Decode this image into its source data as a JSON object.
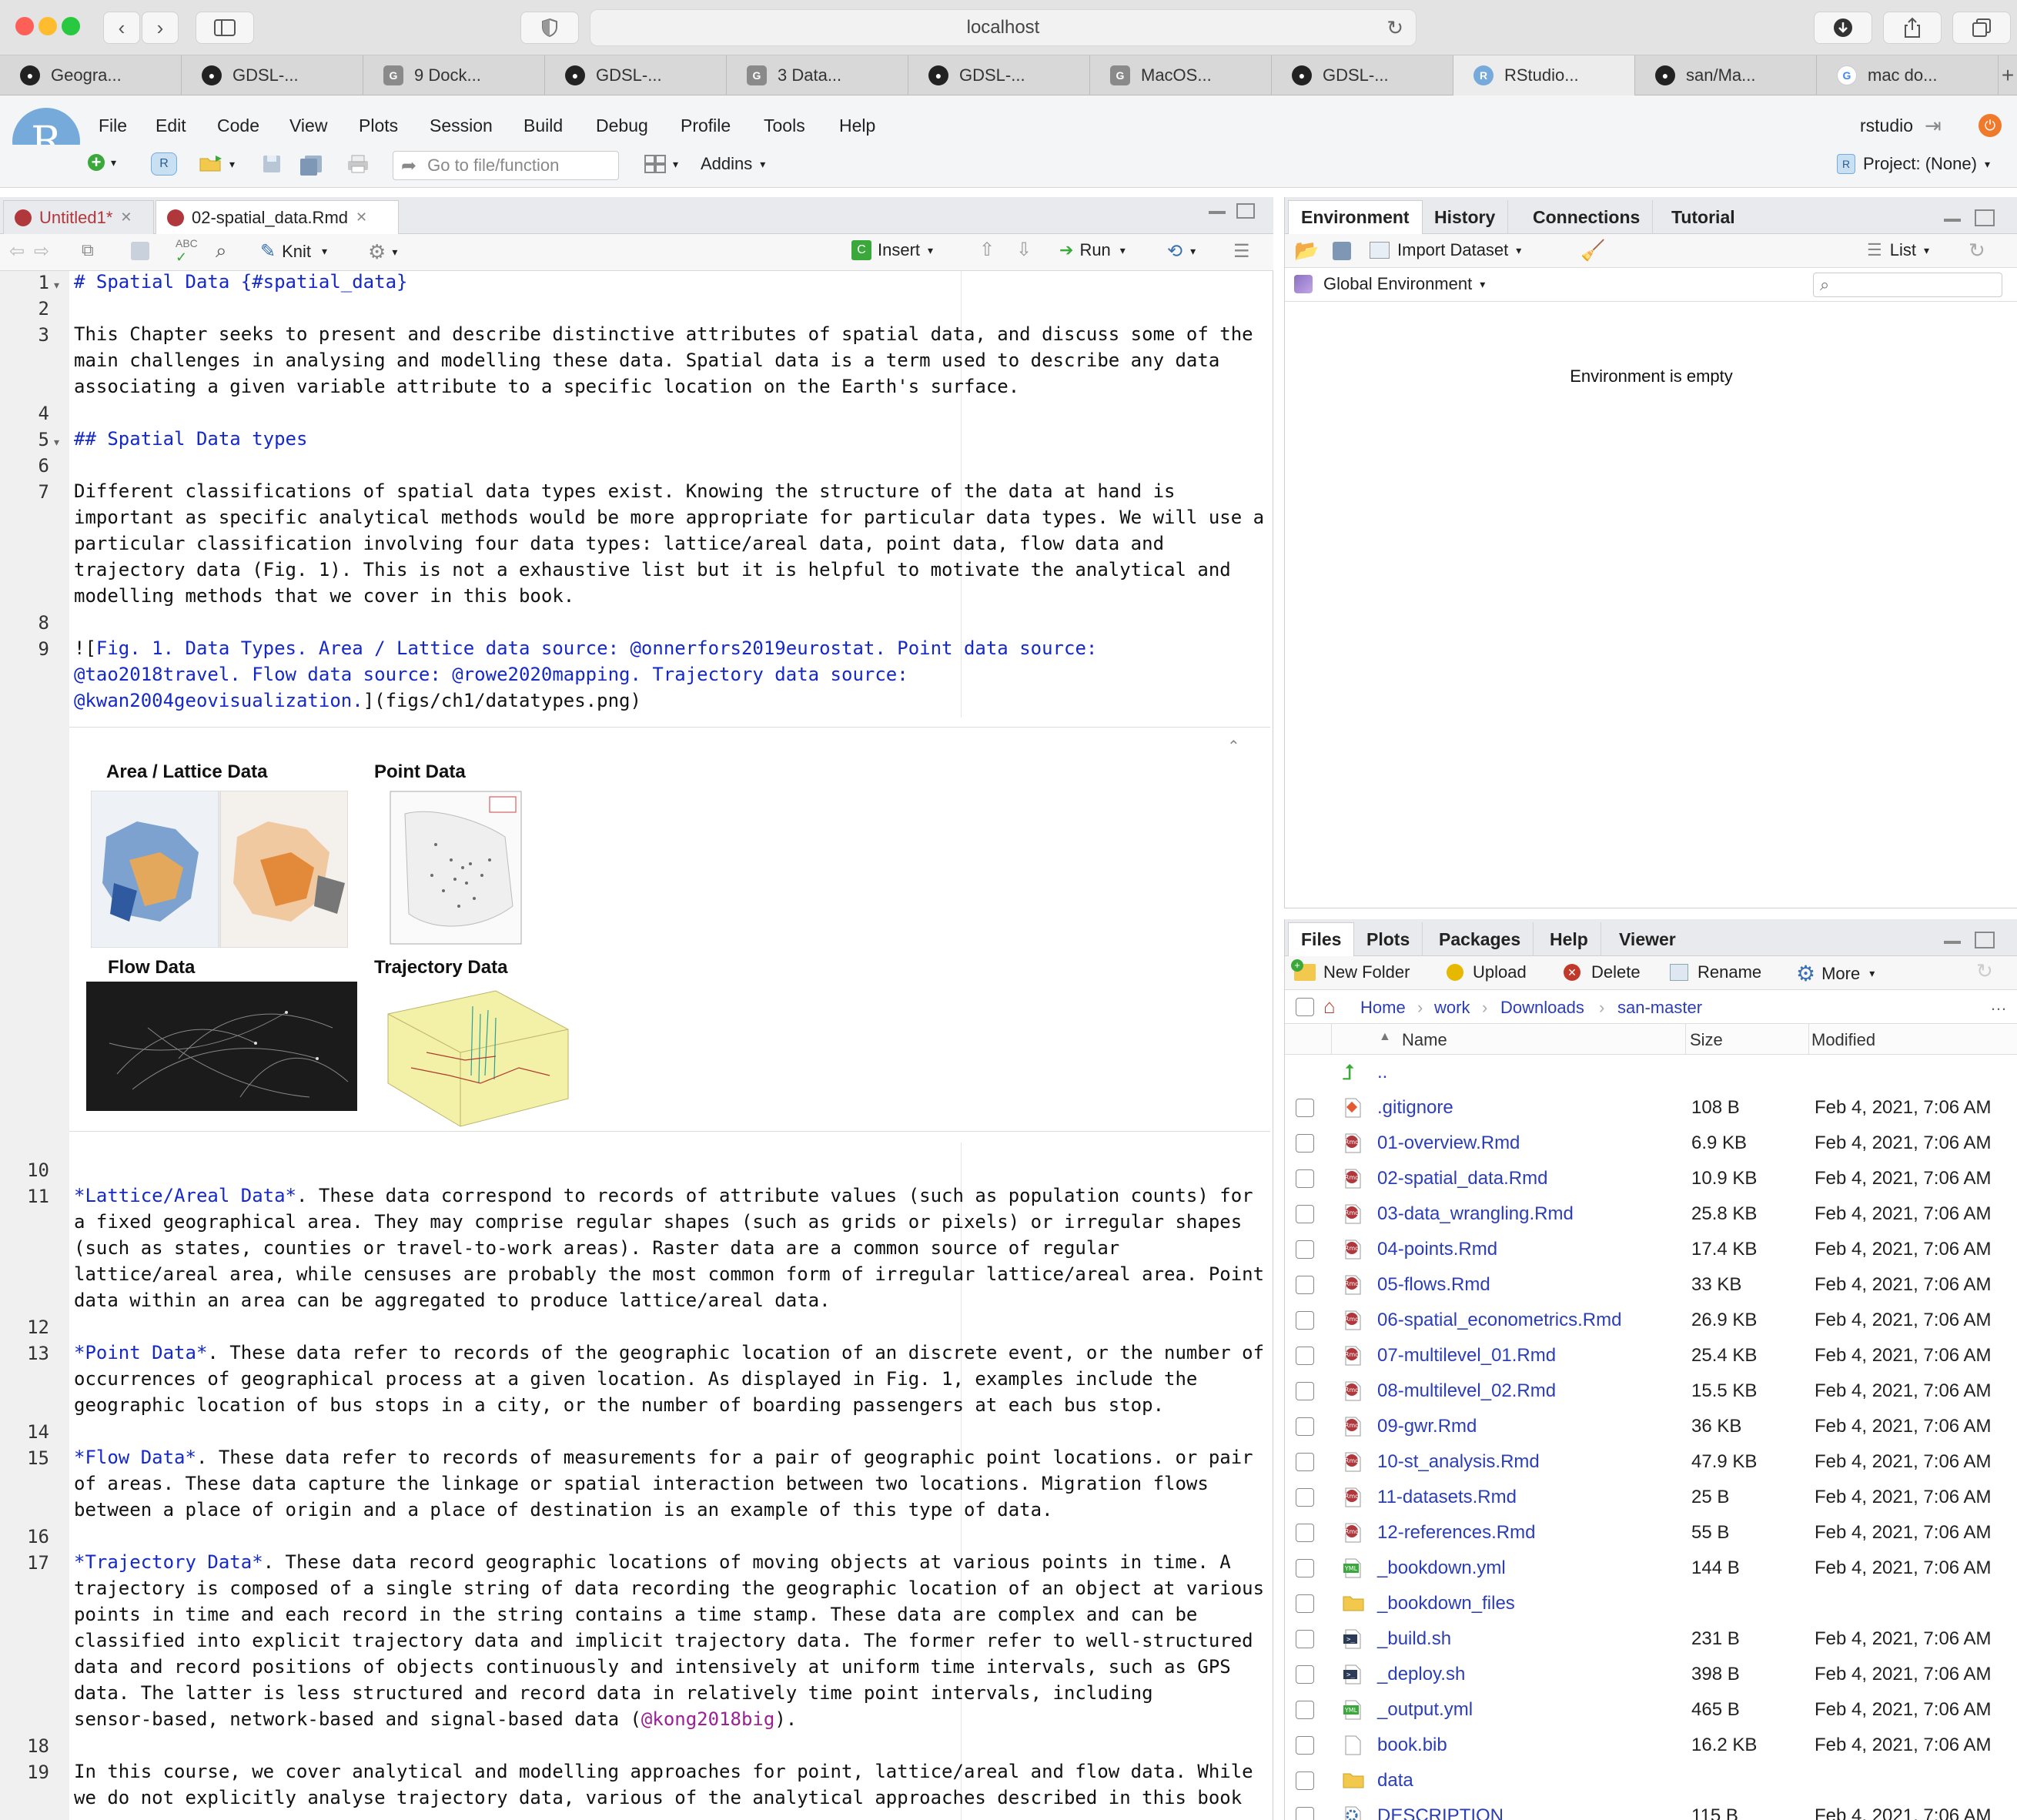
{
  "browser": {
    "url": "localhost",
    "tabs": [
      {
        "label": "Geogra...",
        "icon": "github-icon"
      },
      {
        "label": "GDSL-...",
        "icon": "github-icon"
      },
      {
        "label": "9 Dock...",
        "icon": "g-icon"
      },
      {
        "label": "GDSL-...",
        "icon": "github-icon"
      },
      {
        "label": "3 Data...",
        "icon": "g-icon"
      },
      {
        "label": "GDSL-...",
        "icon": "github-icon"
      },
      {
        "label": "MacOS...",
        "icon": "g-icon"
      },
      {
        "label": "GDSL-...",
        "icon": "github-icon"
      },
      {
        "label": "RStudio...",
        "icon": "rstudio-icon"
      },
      {
        "label": "san/Ma...",
        "icon": "github-icon"
      },
      {
        "label": "mac do...",
        "icon": "google-icon"
      }
    ]
  },
  "rstudio": {
    "logo": "R",
    "menu": [
      "File",
      "Edit",
      "Code",
      "View",
      "Plots",
      "Session",
      "Build",
      "Debug",
      "Profile",
      "Tools",
      "Help"
    ],
    "user": "rstudio",
    "goto_placeholder": "Go to file/function",
    "addins": "Addins",
    "project": "Project: (None)"
  },
  "editor": {
    "tabs": [
      {
        "label": "Untitled1*",
        "modified": true
      },
      {
        "label": "02-spatial_data.Rmd",
        "modified": false
      }
    ],
    "toolbar": {
      "knit": "Knit",
      "insert": "Insert",
      "run": "Run"
    },
    "lines": [
      {
        "n": "1",
        "parts": [
          {
            "t": "# Spatial Data {#spatial_data}",
            "c": "hd"
          }
        ]
      },
      {
        "n": "2",
        "parts": []
      },
      {
        "n": "3",
        "parts": [
          {
            "t": "This Chapter seeks to present and describe distinctive attributes of spatial data, and discuss some of the\nmain challenges in analysing and modelling these data. Spatial data is a term used to describe any data\nassociating a given variable attribute to a specific location on the Earth's surface.",
            "c": ""
          }
        ]
      },
      {
        "n": "4",
        "parts": []
      },
      {
        "n": "5",
        "parts": [
          {
            "t": "## Spatial Data types",
            "c": "hd"
          }
        ]
      },
      {
        "n": "6",
        "parts": []
      },
      {
        "n": "7",
        "parts": [
          {
            "t": "Different classifications of spatial data types exist. Knowing the structure of the data at hand is\nimportant as specific analytical methods would be more appropriate for particular data types. We will use a\nparticular classification involving four data types: lattice/areal data, point data, flow data and\ntrajectory data (Fig. 1). This is not a exhaustive list but it is helpful to motivate the analytical and\nmodelling methods that we cover in this book.",
            "c": ""
          }
        ]
      },
      {
        "n": "8",
        "parts": []
      },
      {
        "n": "9",
        "parts": [
          {
            "t": "![",
            "c": ""
          },
          {
            "t": "Fig. 1. Data Types. Area / Lattice data source: @onnerfors2019eurostat. Point data source:\n@tao2018travel. Flow data source: @rowe2020mapping. Trajectory data source:\n@kwan2004geovisualization.",
            "c": "lk"
          },
          {
            "t": "](figs/ch1/datatypes.png)",
            "c": ""
          }
        ]
      }
    ],
    "figure_labels": {
      "area": "Area / Lattice Data",
      "point": "Point Data",
      "flow": "Flow Data",
      "trajectory": "Trajectory Data"
    },
    "lines2": [
      {
        "n": "10",
        "parts": []
      },
      {
        "n": "11",
        "parts": [
          {
            "t": "*Lattice/Areal Data*",
            "c": "lk"
          },
          {
            "t": ". These data correspond to records of attribute values (such as population counts) for\na fixed geographical area. They may comprise regular shapes (such as grids or pixels) or irregular shapes\n(such as states, counties or travel-to-work areas). Raster data are a common source of regular\nlattice/areal area, while censuses are probably the most common form of irregular lattice/areal area. Point\ndata within an area can be aggregated to produce lattice/areal data.",
            "c": ""
          }
        ]
      },
      {
        "n": "12",
        "parts": []
      },
      {
        "n": "13",
        "parts": [
          {
            "t": "*Point Data*",
            "c": "lk"
          },
          {
            "t": ". These data refer to records of the geographic location of an discrete event, or the number of\noccurrences of geographical process at a given location. As displayed in Fig. 1, examples include the\ngeographic location of bus stops in a city, or the number of boarding passengers at each bus stop.",
            "c": ""
          }
        ]
      },
      {
        "n": "14",
        "parts": []
      },
      {
        "n": "15",
        "parts": [
          {
            "t": "*Flow Data*",
            "c": "lk"
          },
          {
            "t": ". These data refer to records of measurements for a pair of geographic point locations. or pair\nof areas. These data capture the linkage or spatial interaction between two locations. Migration flows\nbetween a place of origin and a place of destination is an example of this type of data.",
            "c": ""
          }
        ]
      },
      {
        "n": "16",
        "parts": []
      },
      {
        "n": "17",
        "parts": [
          {
            "t": "*Trajectory Data*",
            "c": "lk"
          },
          {
            "t": ". These data record geographic locations of moving objects at various points in time. A\ntrajectory is composed of a single string of data recording the geographic location of an object at various\npoints in time and each record in the string contains a time stamp. These data are complex and can be\nclassified into explicit trajectory data and implicit trajectory data. The former refer to well-structured\ndata and record positions of objects continuously and intensively at uniform time intervals, such as GPS\ndata. The latter is less structured and record data in relatively time point intervals, including\nsensor-based, network-based and signal-based data (",
            "c": ""
          },
          {
            "t": "@kong2018big",
            "c": "cite"
          },
          {
            "t": ").",
            "c": ""
          }
        ]
      },
      {
        "n": "18",
        "parts": []
      },
      {
        "n": "19",
        "parts": [
          {
            "t": "In this course, we cover analytical and modelling approaches for point, lattice/areal and flow data. While\nwe do not explicitly analyse trajectory data, various of the analytical approaches described in this book",
            "c": ""
          }
        ]
      }
    ]
  },
  "environment": {
    "tabs": [
      "Environment",
      "History",
      "Connections",
      "Tutorial"
    ],
    "import_dataset": "Import Dataset",
    "list_view": "List",
    "scope": "Global Environment",
    "empty_message": "Environment is empty"
  },
  "files": {
    "tabs": [
      "Files",
      "Plots",
      "Packages",
      "Help",
      "Viewer"
    ],
    "actions": {
      "new_folder": "New Folder",
      "upload": "Upload",
      "delete": "Delete",
      "rename": "Rename",
      "more": "More"
    },
    "breadcrumb": [
      "Home",
      "work",
      "Downloads",
      "san-master"
    ],
    "columns": {
      "name": "Name",
      "size": "Size",
      "modified": "Modified"
    },
    "parent": "..",
    "rows": [
      {
        "name": ".gitignore",
        "size": "108 B",
        "modified": "Feb 4, 2021, 7:06 AM",
        "icon": "git-file-icon"
      },
      {
        "name": "01-overview.Rmd",
        "size": "6.9 KB",
        "modified": "Feb 4, 2021, 7:06 AM",
        "icon": "rmd-file-icon"
      },
      {
        "name": "02-spatial_data.Rmd",
        "size": "10.9 KB",
        "modified": "Feb 4, 2021, 7:06 AM",
        "icon": "rmd-file-icon"
      },
      {
        "name": "03-data_wrangling.Rmd",
        "size": "25.8 KB",
        "modified": "Feb 4, 2021, 7:06 AM",
        "icon": "rmd-file-icon"
      },
      {
        "name": "04-points.Rmd",
        "size": "17.4 KB",
        "modified": "Feb 4, 2021, 7:06 AM",
        "icon": "rmd-file-icon"
      },
      {
        "name": "05-flows.Rmd",
        "size": "33 KB",
        "modified": "Feb 4, 2021, 7:06 AM",
        "icon": "rmd-file-icon"
      },
      {
        "name": "06-spatial_econometrics.Rmd",
        "size": "26.9 KB",
        "modified": "Feb 4, 2021, 7:06 AM",
        "icon": "rmd-file-icon"
      },
      {
        "name": "07-multilevel_01.Rmd",
        "size": "25.4 KB",
        "modified": "Feb 4, 2021, 7:06 AM",
        "icon": "rmd-file-icon"
      },
      {
        "name": "08-multilevel_02.Rmd",
        "size": "15.5 KB",
        "modified": "Feb 4, 2021, 7:06 AM",
        "icon": "rmd-file-icon"
      },
      {
        "name": "09-gwr.Rmd",
        "size": "36 KB",
        "modified": "Feb 4, 2021, 7:06 AM",
        "icon": "rmd-file-icon"
      },
      {
        "name": "10-st_analysis.Rmd",
        "size": "47.9 KB",
        "modified": "Feb 4, 2021, 7:06 AM",
        "icon": "rmd-file-icon"
      },
      {
        "name": "11-datasets.Rmd",
        "size": "25 B",
        "modified": "Feb 4, 2021, 7:06 AM",
        "icon": "rmd-file-icon"
      },
      {
        "name": "12-references.Rmd",
        "size": "55 B",
        "modified": "Feb 4, 2021, 7:06 AM",
        "icon": "rmd-file-icon"
      },
      {
        "name": "_bookdown.yml",
        "size": "144 B",
        "modified": "Feb 4, 2021, 7:06 AM",
        "icon": "yml-file-icon"
      },
      {
        "name": "_bookdown_files",
        "size": "",
        "modified": "",
        "icon": "folder-icon"
      },
      {
        "name": "_build.sh",
        "size": "231 B",
        "modified": "Feb 4, 2021, 7:06 AM",
        "icon": "shell-file-icon"
      },
      {
        "name": "_deploy.sh",
        "size": "398 B",
        "modified": "Feb 4, 2021, 7:06 AM",
        "icon": "shell-file-icon"
      },
      {
        "name": "_output.yml",
        "size": "465 B",
        "modified": "Feb 4, 2021, 7:06 AM",
        "icon": "yml-file-icon"
      },
      {
        "name": "book.bib",
        "size": "16.2 KB",
        "modified": "Feb 4, 2021, 7:06 AM",
        "icon": "text-file-icon"
      },
      {
        "name": "data",
        "size": "",
        "modified": "",
        "icon": "folder-icon"
      },
      {
        "name": "DESCRIPTION",
        "size": "115 B",
        "modified": "Feb 4, 2021, 7:06 AM",
        "icon": "gear-file-icon"
      }
    ]
  },
  "colors": {
    "accent": "#75aadb",
    "link": "#1529c8",
    "rmd": "#b0373b"
  }
}
